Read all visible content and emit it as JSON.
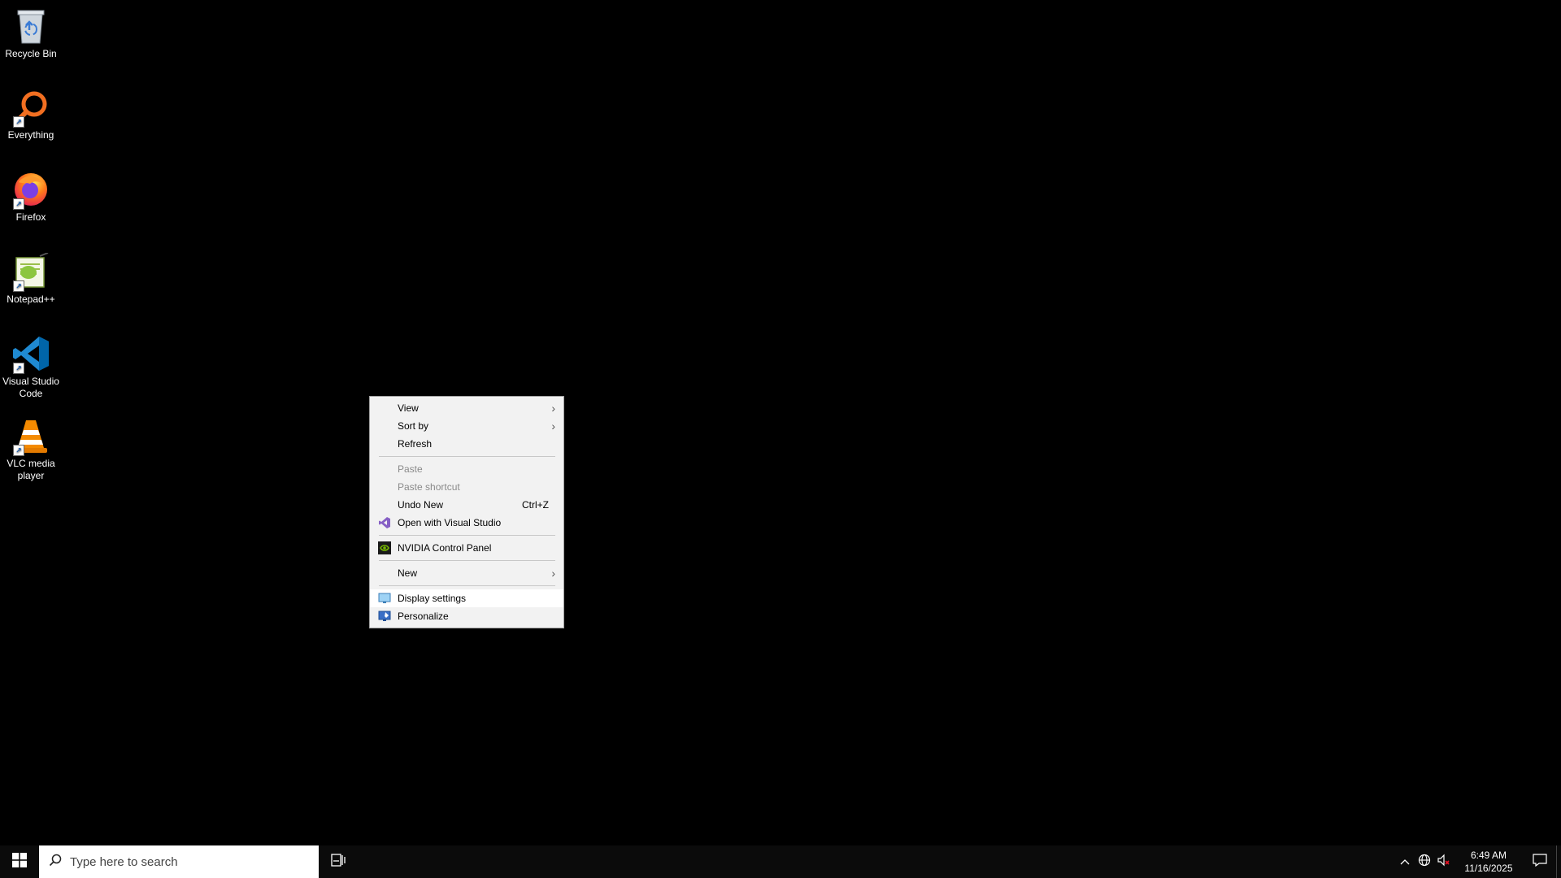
{
  "desktop": {
    "icons": [
      {
        "label": "Recycle Bin",
        "icon": "recycle-bin-icon"
      },
      {
        "label": "Everything",
        "icon": "everything-search-icon"
      },
      {
        "label": "Firefox",
        "icon": "firefox-icon"
      },
      {
        "label": "Notepad++",
        "icon": "notepad-plus-plus-icon"
      },
      {
        "label": "Visual Studio Code",
        "icon": "vscode-icon"
      },
      {
        "label": "VLC media player",
        "icon": "vlc-icon"
      }
    ]
  },
  "context_menu": {
    "view": {
      "label": "View"
    },
    "sort_by": {
      "label": "Sort by"
    },
    "refresh": {
      "label": "Refresh"
    },
    "paste": {
      "label": "Paste"
    },
    "paste_shortcut": {
      "label": "Paste shortcut"
    },
    "undo_new": {
      "label": "Undo New",
      "shortcut": "Ctrl+Z"
    },
    "open_vs": {
      "label": "Open with Visual Studio"
    },
    "nvidia": {
      "label": "NVIDIA Control Panel"
    },
    "new": {
      "label": "New"
    },
    "display_settings": {
      "label": "Display settings"
    },
    "personalize": {
      "label": "Personalize"
    }
  },
  "taskbar": {
    "search_placeholder": "Type here to search",
    "time": "6:49 AM",
    "date": "11/16/2025"
  },
  "colors": {
    "desktop_bg": "#000000",
    "menu_bg": "#f2f2f2",
    "taskbar_bg": "#0b0b0b",
    "vs_purple": "#865fc5",
    "nvidia_green": "#76b900",
    "vscode_blue": "#0078d4",
    "vlc_orange": "#f48a00"
  }
}
